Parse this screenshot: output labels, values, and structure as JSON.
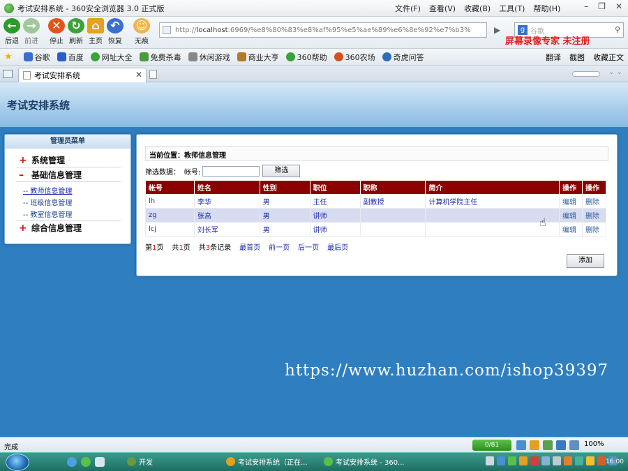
{
  "browser": {
    "window_title": "考试安排系统 - 360安全浏览器 3.0 正式版",
    "menus": [
      "文件(F)",
      "查看(V)",
      "收藏(B)",
      "工具(T)",
      "帮助(H)"
    ],
    "window_buttons": [
      "–",
      "❐",
      "✕"
    ],
    "toolbar": {
      "back": "后退",
      "forward": "前进",
      "stop": "停止",
      "refresh": "刷新",
      "home": "主页",
      "restore": "恢复",
      "incognito": "无痕"
    },
    "address_prefix": "http://",
    "address_host": "localhost",
    "address_rest": ":6969/%e8%80%83%e8%af%95%e5%ae%89%e6%8e%92%e7%b3%",
    "search_placeholder": "谷歌",
    "recorder_watermark": "屏幕录像专家  未注册",
    "favorites": [
      "谷歌",
      "百度",
      "网址大全",
      "免费杀毒",
      "休闲游戏",
      "商业大亨",
      "360帮助",
      "360农场",
      "奇虎问答"
    ],
    "favorites_right": [
      "翻译",
      "截图",
      "收藏正文"
    ],
    "tab_title": "考试安排系统",
    "tab_close": "✕",
    "status_text": "完成",
    "status_counter": "0/81",
    "zoom": "100%"
  },
  "app": {
    "system_title": "考试安排系统",
    "menu_head": "管理员菜单",
    "menu_groups": [
      {
        "sign": "+",
        "label": "系统管理"
      },
      {
        "sign": "–",
        "label": "基础信息管理"
      },
      {
        "sign": "+",
        "label": "综合信息管理"
      }
    ],
    "menu_subitems": [
      "-- 教师信息管理",
      "-- 班级信息管理",
      "-- 教室信息管理"
    ],
    "breadcrumb": "当前位置：教师信息管理",
    "filter_label": "筛选数据：",
    "account_label": "帐号:",
    "filter_value": "",
    "filter_button": "筛选",
    "table": {
      "headers": [
        "帐号",
        "姓名",
        "性别",
        "职位",
        "职称",
        "简介",
        "操作",
        "操作"
      ],
      "rows": [
        [
          "lh",
          "李华",
          "男",
          "主任",
          "副教授",
          "计算机学院主任",
          "编辑",
          "删除"
        ],
        [
          "zg",
          "张高",
          "男",
          "讲师",
          "",
          "",
          "编辑",
          "删除"
        ],
        [
          "lcj",
          "刘长军",
          "男",
          "讲师",
          "",
          "",
          "编辑",
          "删除"
        ]
      ]
    },
    "pager": {
      "page_prefix": "第",
      "page_num": "1",
      "page_suffix": "页",
      "total_prefix": "共",
      "total_num": "1",
      "total_suffix": "页",
      "records_prefix": "共",
      "records_num": "3",
      "records_suffix": "条记录",
      "first": "最首页",
      "prev": "前一页",
      "next": "后一页",
      "last": "最后页"
    },
    "add_button": "添加"
  },
  "overlay_watermark": "https://www.huzhan.com/ishop39397",
  "taskbar": {
    "dev_label": "开发",
    "tasks": [
      "考试安排系统（正在...",
      "考试安排系统 - 360..."
    ],
    "clock": "16:00"
  },
  "colors": {
    "table_header": "#8b0000",
    "page_bg": "#2f7fc0",
    "link": "#1d2aa8",
    "plus_minus": "#d01010",
    "recorder_red": "#e0201e"
  }
}
